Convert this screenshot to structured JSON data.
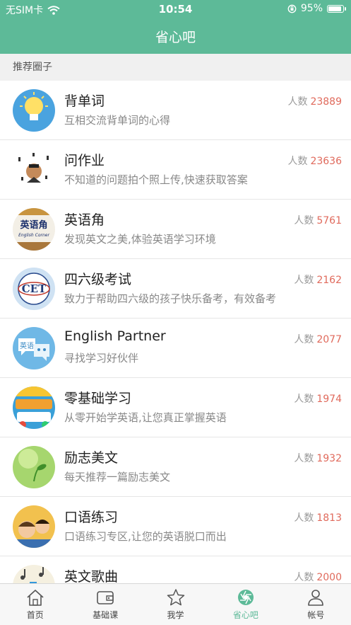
{
  "status_bar": {
    "carrier": "无SIM卡",
    "time": "10:54",
    "battery": "95%",
    "battery_level": 0.95
  },
  "nav": {
    "title": "省心吧"
  },
  "section": {
    "header": "推荐圈子"
  },
  "list": {
    "count_label": "人数",
    "items": [
      {
        "title": "背单词",
        "desc": "互相交流背单词的心得",
        "count": "23889",
        "icon": "lightbulb-avatar"
      },
      {
        "title": "问作业",
        "desc": "不知道的问题拍个照上传,快速获取答案",
        "count": "23636",
        "icon": "question-avatar"
      },
      {
        "title": "英语角",
        "desc": "发现英文之美,体验英语学习环境",
        "count": "5761",
        "icon": "english-corner-avatar",
        "image_text": [
          "英语角",
          "English Corner"
        ]
      },
      {
        "title": "四六级考试",
        "desc": "致力于帮助四六级的孩子快乐备考，有效备考",
        "count": "2162",
        "icon": "cet-avatar",
        "image_text": "CET"
      },
      {
        "title": "English Partner",
        "desc": "寻找学习好伙伴",
        "count": "2077",
        "icon": "chat-bubbles-avatar",
        "image_text": "英语"
      },
      {
        "title": "零基础学习",
        "desc": "从零开始学英语,让您真正掌握英语",
        "count": "1974",
        "icon": "kids-english-avatar"
      },
      {
        "title": "励志美文",
        "desc": "每天推荐一篇励志美文",
        "count": "1932",
        "icon": "sprout-avatar"
      },
      {
        "title": "口语练习",
        "desc": "口语练习专区,让您的英语脱口而出",
        "count": "1813",
        "icon": "speaking-avatar"
      },
      {
        "title": "英文歌曲",
        "desc": "",
        "count": "2000",
        "icon": "songs-avatar"
      }
    ]
  },
  "tabs": [
    {
      "label": "首页",
      "icon": "home-icon"
    },
    {
      "label": "基础课",
      "icon": "wallet-icon"
    },
    {
      "label": "我学",
      "icon": "star-icon"
    },
    {
      "label": "省心吧",
      "icon": "aperture-icon",
      "active": true
    },
    {
      "label": "帐号",
      "icon": "user-icon"
    }
  ],
  "colors": {
    "accent": "#5dba98",
    "count": "#e06a5c"
  }
}
